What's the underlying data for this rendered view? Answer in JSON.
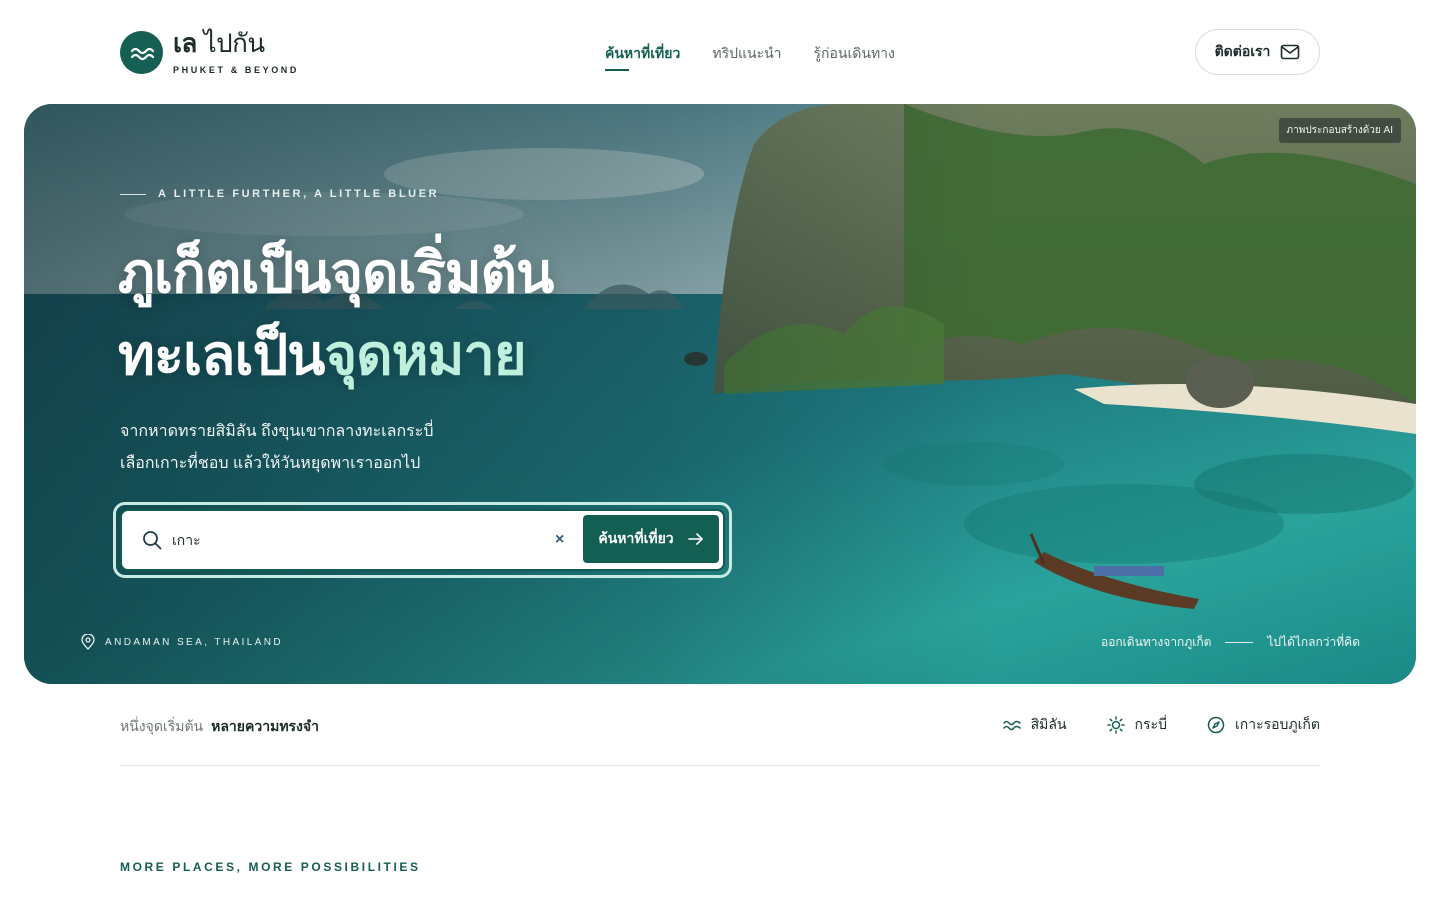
{
  "brand": {
    "name_bold": "เล",
    "name_light": "ไปกัน",
    "subtitle": "PHUKET & BEYOND",
    "icon": "wave-logo-icon"
  },
  "nav": {
    "items": [
      {
        "label": "ค้นหาที่เที่ยว",
        "active": true
      },
      {
        "label": "ทริปแนะนำ",
        "active": false
      },
      {
        "label": "รู้ก่อนเดินทาง",
        "active": false
      }
    ],
    "contact_label": "ติดต่อเรา",
    "contact_icon": "mail-icon"
  },
  "hero": {
    "ai_badge": "ภาพประกอบสร้างด้วย AI",
    "tagline": "A LITTLE FURTHER, A LITTLE BLUER",
    "headline_line1": "ภูเก็ตเป็นจุดเริ่มต้น",
    "headline_line2_plain": "ทะเลเป็น",
    "headline_line2_accent": "จุดหมาย",
    "desc_line1": "จากหาดทรายสิมิลัน ถึงขุนเขากลางทะเลกระบี่",
    "desc_line2": "เลือกเกาะที่ชอบ แล้วให้วันหยุดพาเราออกไป",
    "search": {
      "value": "เกาะ",
      "clear_symbol": "×",
      "button_label": "ค้นหาที่เที่ยว"
    },
    "location": "ANDAMAN SEA, THAILAND",
    "route_from": "ออกเดินทางจากภูเก็ต",
    "route_to": "ไปได้ไกลกว่าที่คิด"
  },
  "subbar": {
    "lead": "หนึ่งจุดเริ่มต้น",
    "lead_bold": "หลายความทรงจำ",
    "chips": [
      {
        "label": "สิมิลัน",
        "icon": "waves-icon"
      },
      {
        "label": "กระบี่",
        "icon": "sun-icon"
      },
      {
        "label": "เกาะรอบภูเก็ต",
        "icon": "compass-icon"
      }
    ]
  },
  "section": {
    "kicker": "MORE PLACES, MORE POSSIBILITIES"
  },
  "colors": {
    "brand": "#155f54",
    "accent_mint": "#bff0de",
    "text": "#1d2b2a"
  }
}
